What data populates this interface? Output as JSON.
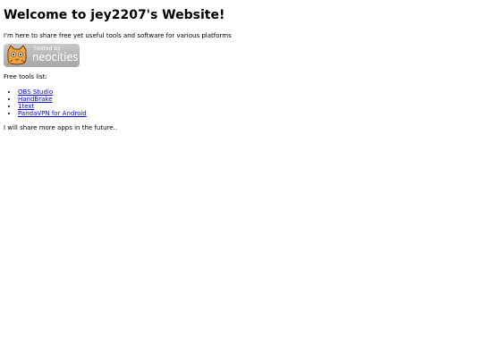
{
  "header": {
    "title": "Welcome to jey2207's Website!"
  },
  "intro": {
    "text": "I'm here to share free yet useful tools and software for various platforms"
  },
  "badge": {
    "small_text": "hosted by",
    "brand_text": "neocities"
  },
  "tools": {
    "label": "Free tools list:",
    "items": [
      {
        "label": "OBS Studio"
      },
      {
        "label": "HandBrake"
      },
      {
        "label": "1text"
      },
      {
        "label": "PandaVPN for Android"
      }
    ]
  },
  "footer": {
    "text": "I will share more apps in the future.."
  },
  "colors": {
    "link": "#0000ee",
    "badge_bg": "#b5b5b5",
    "cat_orange": "#f2a43a"
  }
}
